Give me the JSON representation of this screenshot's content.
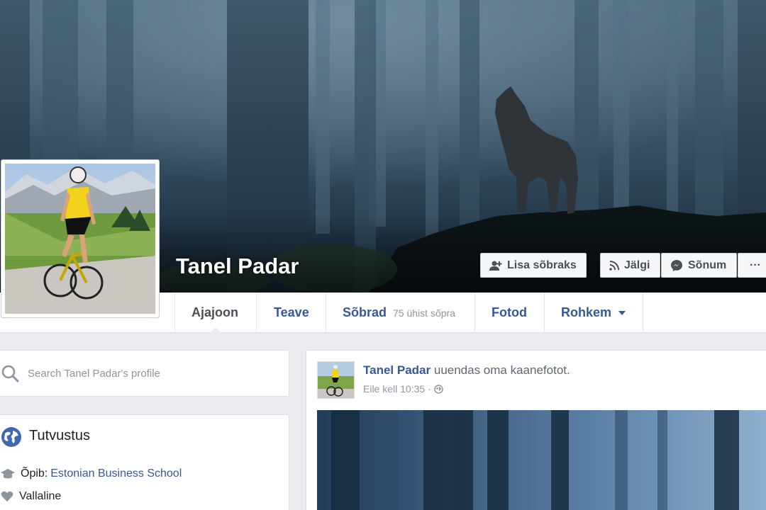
{
  "profile": {
    "name": "Tanel Padar"
  },
  "cover_actions": {
    "add_friend": "Lisa sõbraks",
    "follow": "Jälgi",
    "message": "Sõnum",
    "more": "···"
  },
  "nav": {
    "timeline": "Ajajoon",
    "about": "Teave",
    "friends": "Sõbrad",
    "friends_count": "75 ühist sõpra",
    "photos": "Fotod",
    "more": "Rohkem"
  },
  "search": {
    "placeholder": "Search Tanel Padar's profile"
  },
  "intro": {
    "title": "Tutvustus",
    "studies_label": "Õpib:",
    "studies_value": "Estonian Business School",
    "relationship": "Vallaline"
  },
  "post": {
    "author": "Tanel Padar",
    "action": "uuendas oma kaanefotot.",
    "time": "Eile kell 10:35 ·"
  },
  "colors": {
    "link": "#365899",
    "background": "#e9ebee",
    "muted": "#90949c"
  },
  "icons": [
    "add-friend-icon",
    "rss-icon",
    "messenger-icon",
    "search-icon",
    "globe-icon",
    "graduation-cap-icon",
    "heart-icon",
    "public-globe-icon",
    "caret-down-icon"
  ]
}
